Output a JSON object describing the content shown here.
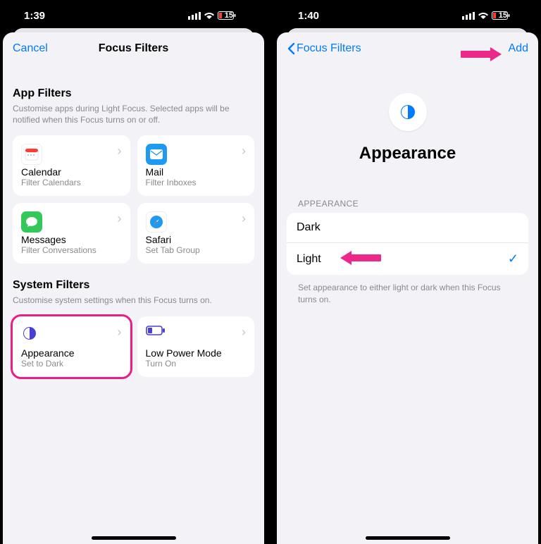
{
  "left": {
    "status": {
      "time": "1:39",
      "battery": "15"
    },
    "nav": {
      "cancel": "Cancel",
      "title": "Focus Filters"
    },
    "appFilters": {
      "title": "App Filters",
      "subtitle": "Customise apps during Light Focus. Selected apps will be notified when this Focus turns on or off.",
      "items": [
        {
          "title": "Calendar",
          "sub": "Filter Calendars",
          "icon": "calendar"
        },
        {
          "title": "Mail",
          "sub": "Filter Inboxes",
          "icon": "mail"
        },
        {
          "title": "Messages",
          "sub": "Filter Conversations",
          "icon": "messages"
        },
        {
          "title": "Safari",
          "sub": "Set Tab Group",
          "icon": "safari"
        }
      ]
    },
    "systemFilters": {
      "title": "System Filters",
      "subtitle": "Customise system settings when this Focus turns on.",
      "items": [
        {
          "title": "Appearance",
          "sub": "Set to Dark",
          "icon": "appearance",
          "highlighted": true
        },
        {
          "title": "Low Power Mode",
          "sub": "Turn On",
          "icon": "battery"
        }
      ]
    }
  },
  "right": {
    "status": {
      "time": "1:40",
      "battery": "15"
    },
    "nav": {
      "back": "Focus Filters",
      "add": "Add"
    },
    "hero": {
      "title": "Appearance"
    },
    "list": {
      "header": "APPEARANCE",
      "rows": [
        {
          "label": "Dark",
          "selected": false
        },
        {
          "label": "Light",
          "selected": true
        }
      ],
      "footer": "Set appearance to either light or dark when this Focus turns on."
    }
  }
}
